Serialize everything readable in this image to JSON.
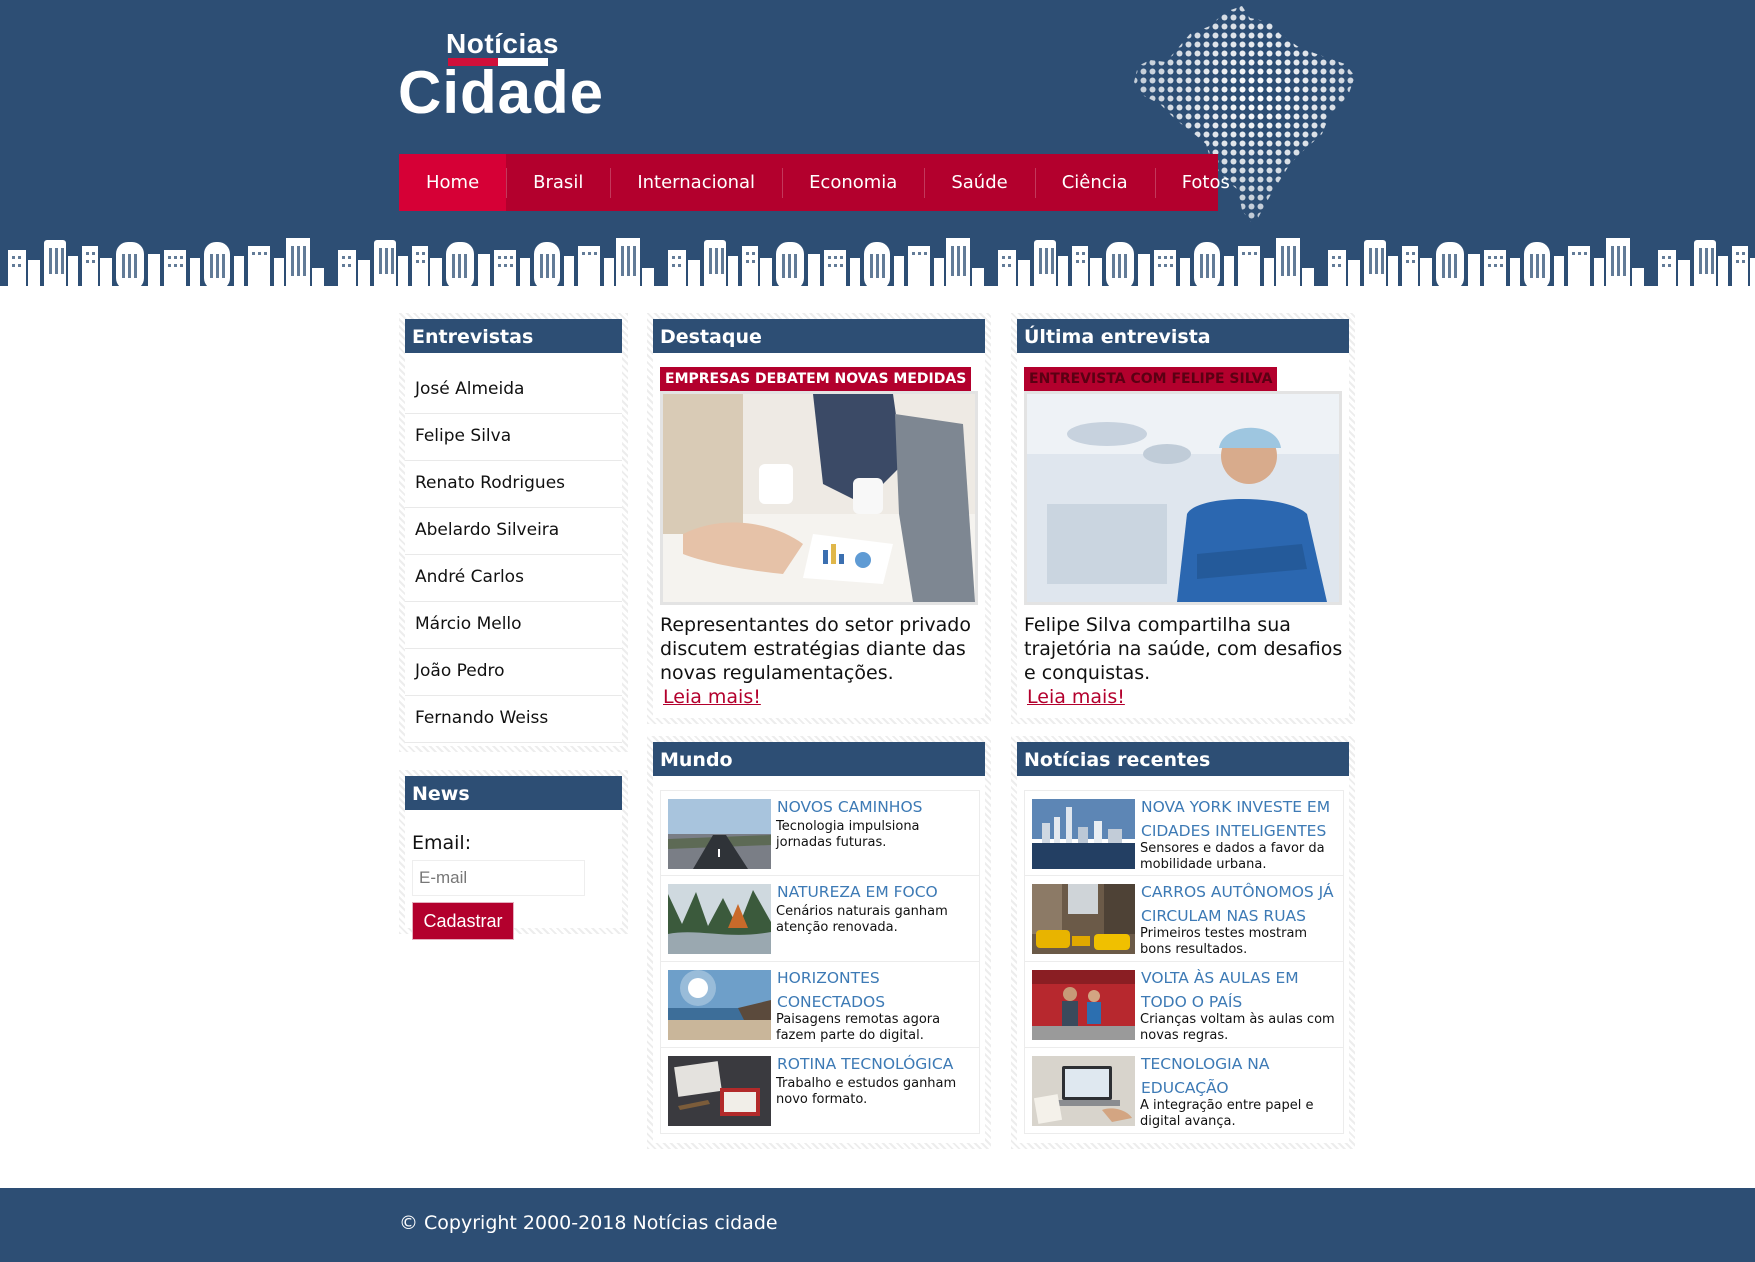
{
  "brand": {
    "top": "Notícias",
    "main": "Cidade",
    "colors": {
      "primary": "#2d4e74",
      "accent": "#b3002d",
      "link": "#3d7ab5"
    }
  },
  "nav": {
    "items": [
      "Home",
      "Brasil",
      "Internacional",
      "Economia",
      "Saúde",
      "Ciência",
      "Fotos"
    ],
    "active": "Home"
  },
  "interviews": {
    "title": "Entrevistas",
    "items": [
      "José Almeida",
      "Felipe Silva",
      "Renato Rodrigues",
      "Abelardo Silveira",
      "André Carlos",
      "Márcio Mello",
      "João Pedro",
      "Fernando Weiss"
    ]
  },
  "newsletter": {
    "title": "News",
    "label": "Email:",
    "placeholder": "E-mail",
    "button": "Cadastrar"
  },
  "highlight": {
    "title": "Destaque",
    "tag": "EMPRESAS DEBATEM NOVAS MEDIDAS",
    "image_icon": "business-meeting-photo",
    "text": "Representantes do setor privado discutem estratégias diante das novas regulamentações.",
    "link": "Leia mais!"
  },
  "latest_interview": {
    "title": "Última entrevista",
    "tag": "ENTREVISTA COM FELIPE SILVA",
    "image_icon": "surgeon-portrait-photo",
    "text": "Felipe Silva compartilha sua trajetória na saúde, com desafios e conquistas.",
    "link": "Leia mais!"
  },
  "world": {
    "title": "Mundo",
    "items": [
      {
        "title": "NOVOS CAMINHOS",
        "desc": "Tecnologia impulsiona jornadas futuras.",
        "thumb": "road-photo"
      },
      {
        "title": "NATUREZA EM FOCO",
        "desc": "Cenários naturais ganham atenção renovada.",
        "thumb": "river-forest-photo"
      },
      {
        "title": "HORIZONTES CONECTADOS",
        "desc": "Paisagens remotas agora fazem parte do digital.",
        "thumb": "beach-sun-photo"
      },
      {
        "title": "ROTINA TECNOLÓGICA",
        "desc": "Trabalho e estudos ganham novo formato.",
        "thumb": "desk-notebook-photo"
      }
    ]
  },
  "recent": {
    "title": "Notícias recentes",
    "items": [
      {
        "title": "NOVA YORK INVESTE EM CIDADES INTELIGENTES",
        "desc": "Sensores e dados a favor da mobilidade urbana.",
        "thumb": "skyline-photo"
      },
      {
        "title": "CARROS AUTÔNOMOS JÁ CIRCULAM NAS RUAS",
        "desc": "Primeiros testes mostram bons resultados.",
        "thumb": "taxi-street-photo"
      },
      {
        "title": "VOLTA ÀS AULAS EM TODO O PAÍS",
        "desc": "Crianças voltam às aulas com novas regras.",
        "thumb": "children-school-photo"
      },
      {
        "title": "TECNOLOGIA NA EDUCAÇÃO",
        "desc": "A integração entre papel e digital avança.",
        "thumb": "laptop-desk-photo"
      }
    ]
  },
  "footer": {
    "copyright": "© Copyright 2000-2018 Notícias cidade"
  }
}
